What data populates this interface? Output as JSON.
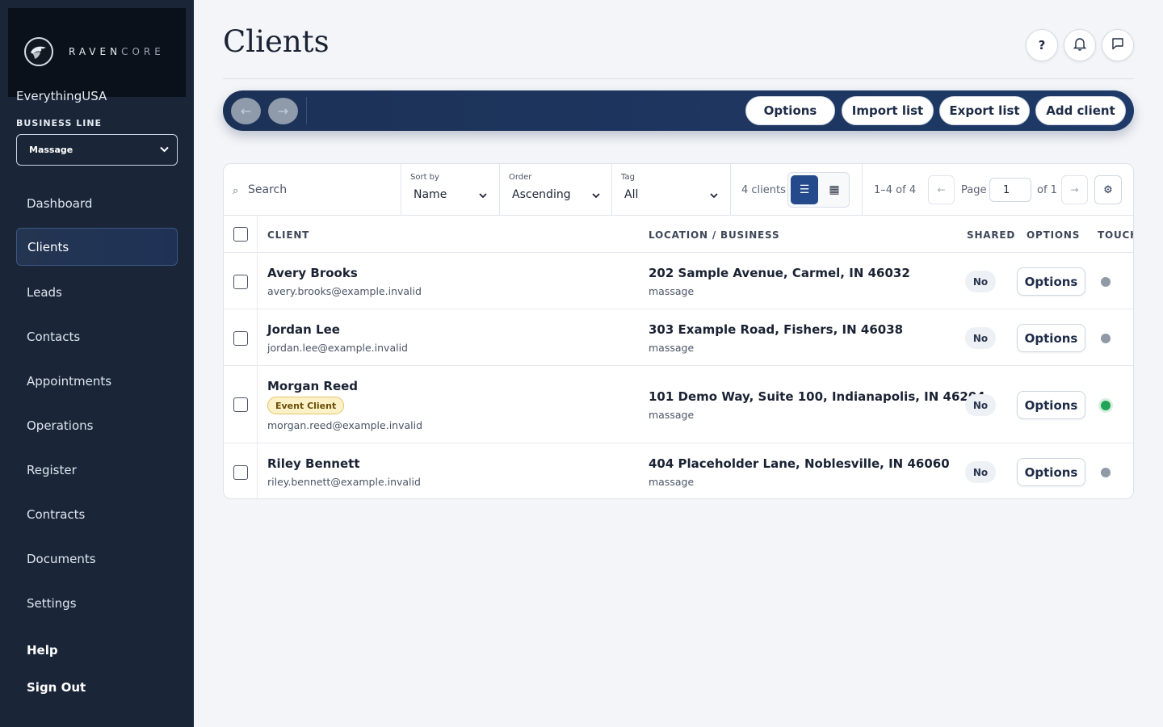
{
  "brand": {
    "name_main": "RAVEN",
    "name_dim": "CORE",
    "org": "EverythingUSA"
  },
  "sidebar": {
    "business_line_label": "BUSINESS LINE",
    "business_line_value": "Massage",
    "items": [
      {
        "label": "Dashboard"
      },
      {
        "label": "Clients",
        "active": true
      },
      {
        "label": "Leads"
      },
      {
        "label": "Contacts"
      },
      {
        "label": "Appointments"
      },
      {
        "label": "Operations"
      },
      {
        "label": "Register"
      },
      {
        "label": "Contracts"
      },
      {
        "label": "Documents"
      },
      {
        "label": "Settings"
      }
    ],
    "help": "Help",
    "sign_out": "Sign Out"
  },
  "header": {
    "title": "Clients",
    "help_icon_text": "?"
  },
  "toolbar": {
    "back": "←",
    "forward": "→",
    "options": "Options",
    "import": "Import list",
    "export": "Export list",
    "add": "Add client"
  },
  "filters": {
    "search_placeholder": "Search",
    "sort_label": "Sort by",
    "sort_value": "Name",
    "order_label": "Order",
    "order_value": "Ascending",
    "tag_label": "Tag",
    "tag_value": "All",
    "count": "4 clients",
    "range": "1–4 of 4",
    "page_label": "Page",
    "page_value": "1",
    "page_of": "of 1",
    "prev": "←",
    "next": "→"
  },
  "table": {
    "headers": {
      "client": "CLIENT",
      "location": "LOCATION / BUSINESS",
      "shared": "SHARED",
      "options": "OPTIONS",
      "touch": "TOUCH"
    },
    "rows": [
      {
        "name": "Avery Brooks",
        "email": "avery.brooks@example.invalid",
        "address": "202 Sample Avenue, Carmel, IN 46032",
        "business": "massage",
        "shared": "No",
        "options": "Options",
        "touch": "gray"
      },
      {
        "name": "Jordan Lee",
        "email": "jordan.lee@example.invalid",
        "address": "303 Example Road, Fishers, IN 46038",
        "business": "massage",
        "shared": "No",
        "options": "Options",
        "touch": "gray"
      },
      {
        "name": "Morgan Reed",
        "badge": "Event Client",
        "email": "morgan.reed@example.invalid",
        "address": "101 Demo Way, Suite 100, Indianapolis, IN 46204",
        "business": "massage",
        "shared": "No",
        "options": "Options",
        "touch": "green"
      },
      {
        "name": "Riley Bennett",
        "email": "riley.bennett@example.invalid",
        "address": "404 Placeholder Lane, Noblesville, IN 46060",
        "business": "massage",
        "shared": "No",
        "options": "Options",
        "touch": "gray"
      }
    ]
  },
  "colors": {
    "sidebar_bg": "#1a2638",
    "toolbar_bg": "#1f3a68",
    "accent": "#254a8c",
    "touch_active": "#22a35a",
    "touch_inactive": "#9099a6"
  }
}
